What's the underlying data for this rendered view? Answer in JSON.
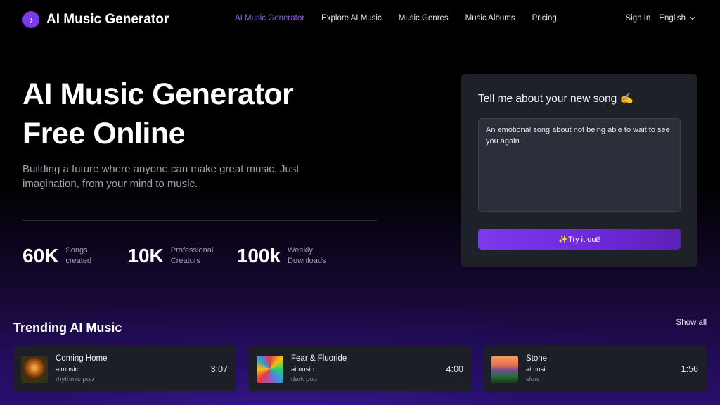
{
  "header": {
    "logo_text": "AI Music Generator",
    "nav": [
      {
        "label": "AI Music Generator",
        "active": true
      },
      {
        "label": "Explore AI Music"
      },
      {
        "label": "Music Genres"
      },
      {
        "label": "Music Albums"
      },
      {
        "label": "Pricing"
      }
    ],
    "sign_in": "Sign In",
    "language": "English"
  },
  "hero": {
    "title_line1": "AI Music Generator",
    "title_line2": "Free Online",
    "subtitle": "Building a future where anyone can make great music. Just imagination, from your mind to music.",
    "stats": [
      {
        "value": "60K",
        "label": "Songs created"
      },
      {
        "value": "10K",
        "label": "Professional Creators"
      },
      {
        "value": "100k",
        "label": "Weekly Downloads"
      }
    ]
  },
  "song_card": {
    "title": "Tell me about your new song ✍️",
    "text": "An emotional song about not being able to wait to see you again",
    "button": "✨Try it out!"
  },
  "trending": {
    "title": "Trending AI Music",
    "show_all": "Show all",
    "tracks": [
      {
        "title": "Coming Home",
        "artist": "aimusic",
        "genre": "rhythmic pop",
        "duration": "3:07"
      },
      {
        "title": "Fear & Fluoride",
        "artist": "aimusic",
        "genre": "dark pop",
        "duration": "4:00"
      },
      {
        "title": "Stone",
        "artist": "aimusic",
        "genre": "slow",
        "duration": "1:56"
      }
    ]
  },
  "colors": {
    "accent": "#7c3aed",
    "nav_active": "#8b5cf6"
  },
  "icons": {
    "logo": "music-note-icon",
    "language": "chevron-down-icon"
  }
}
